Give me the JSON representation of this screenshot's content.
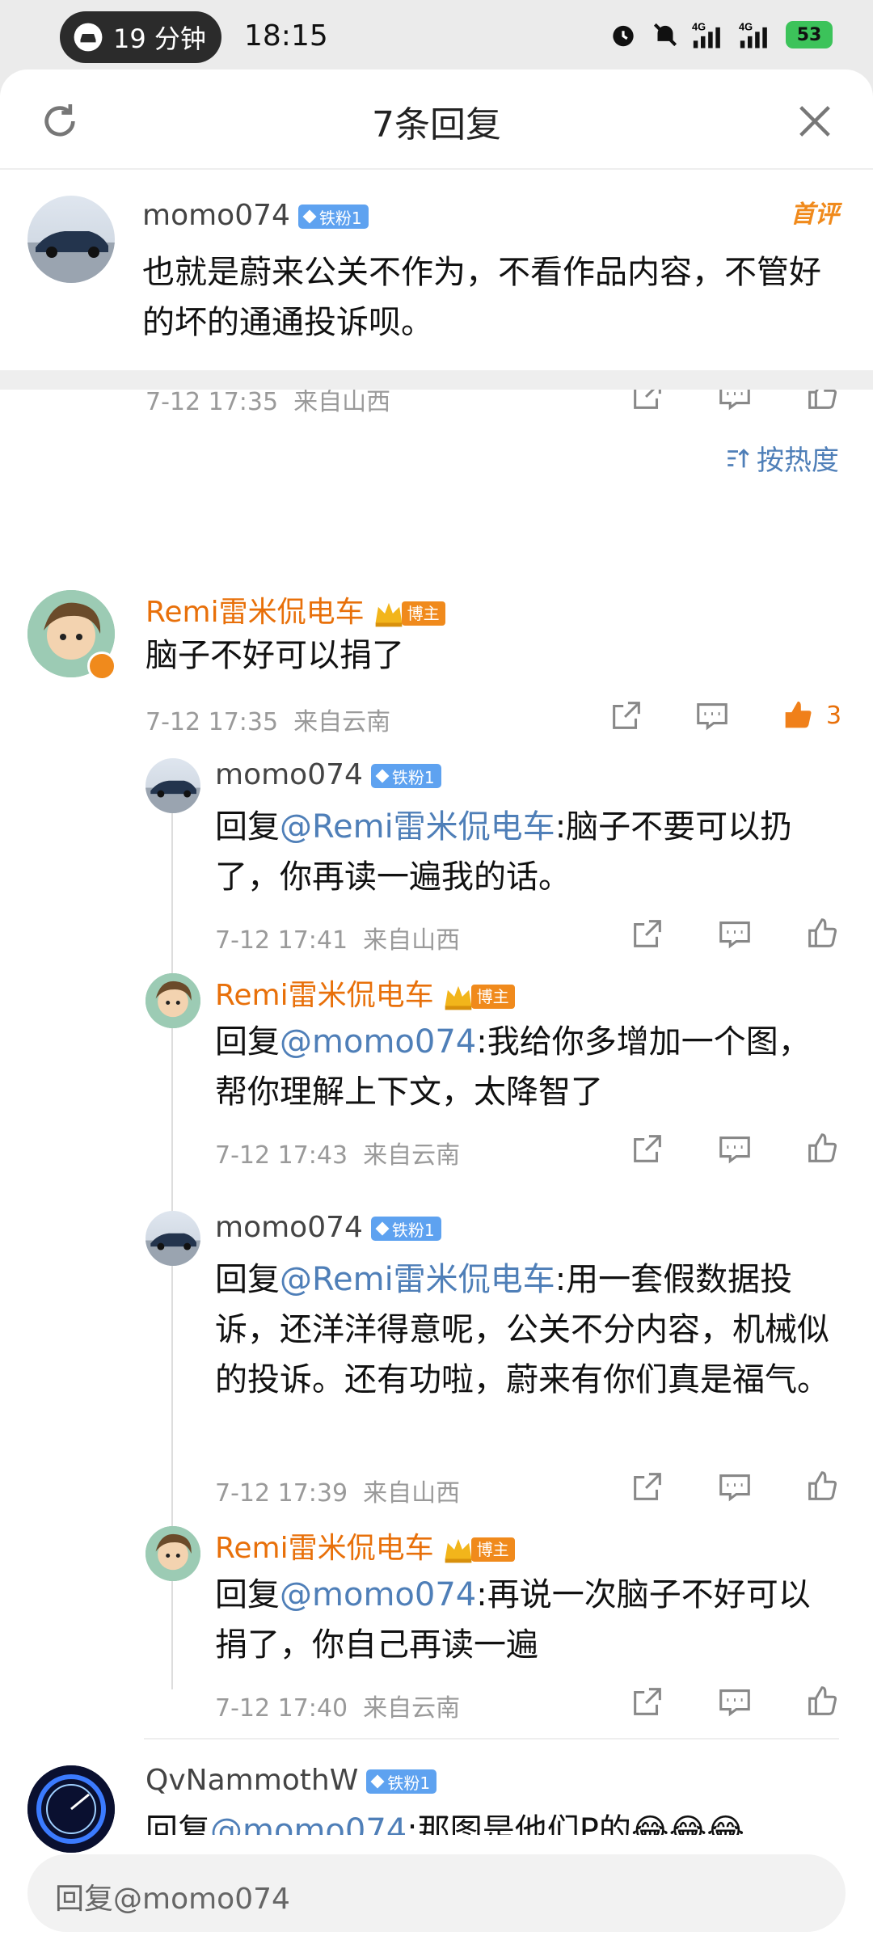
{
  "status": {
    "pill_text": "19 分钟",
    "time": "18:15",
    "net1": "4G",
    "net2": "4G",
    "battery": "53"
  },
  "header": {
    "title": "7条回复"
  },
  "main_comment": {
    "user": "momo074",
    "badge": "铁粉1",
    "tag": "首评",
    "text": "也就是蔚来公关不作为，不看作品内容，不管好的坏的通通投诉呗。",
    "time": "7-12 17:35",
    "loc": "来自山西"
  },
  "sort_label": "按热度",
  "reply_prefix": "回复",
  "replies": [
    {
      "user": "Remi雷米侃电车",
      "badge": "博主",
      "text": "脑子不好可以捐了",
      "time": "7-12 17:35",
      "loc": "来自云南",
      "likes": "3"
    },
    {
      "user": "momo074",
      "badge": "铁粉1",
      "mention": "@Remi雷米侃电车",
      "text": ":脑子不要可以扔了，你再读一遍我的话。",
      "time": "7-12 17:41",
      "loc": "来自山西"
    },
    {
      "user": "Remi雷米侃电车",
      "badge": "博主",
      "mention": "@momo074",
      "text": ":我给你多增加一个图，帮你理解上下文，太降智了",
      "time": "7-12 17:43",
      "loc": "来自云南"
    },
    {
      "user": "momo074",
      "badge": "铁粉1",
      "mention": "@Remi雷米侃电车",
      "text": ":用一套假数据投诉，还洋洋得意呢，公关不分内容，机械似的投诉。还有功啦，蔚来有你们真是福气。",
      "time": "7-12 17:39",
      "loc": "来自山西"
    },
    {
      "user": "Remi雷米侃电车",
      "badge": "博主",
      "mention": "@momo074",
      "text": ":再说一次脑子不好可以捐了，你自己再读一遍",
      "time": "7-12 17:40",
      "loc": "来自云南"
    },
    {
      "user": "QvNammothW",
      "badge": "铁粉1",
      "mention": "@momo074",
      "text": ":那图是他们P的😂😂😂"
    }
  ],
  "input": {
    "placeholder": "回复@momo074"
  },
  "colors": {
    "accent": "#e8700a",
    "link": "#4f7fb8",
    "iron_badge": "#5ea2f0"
  }
}
